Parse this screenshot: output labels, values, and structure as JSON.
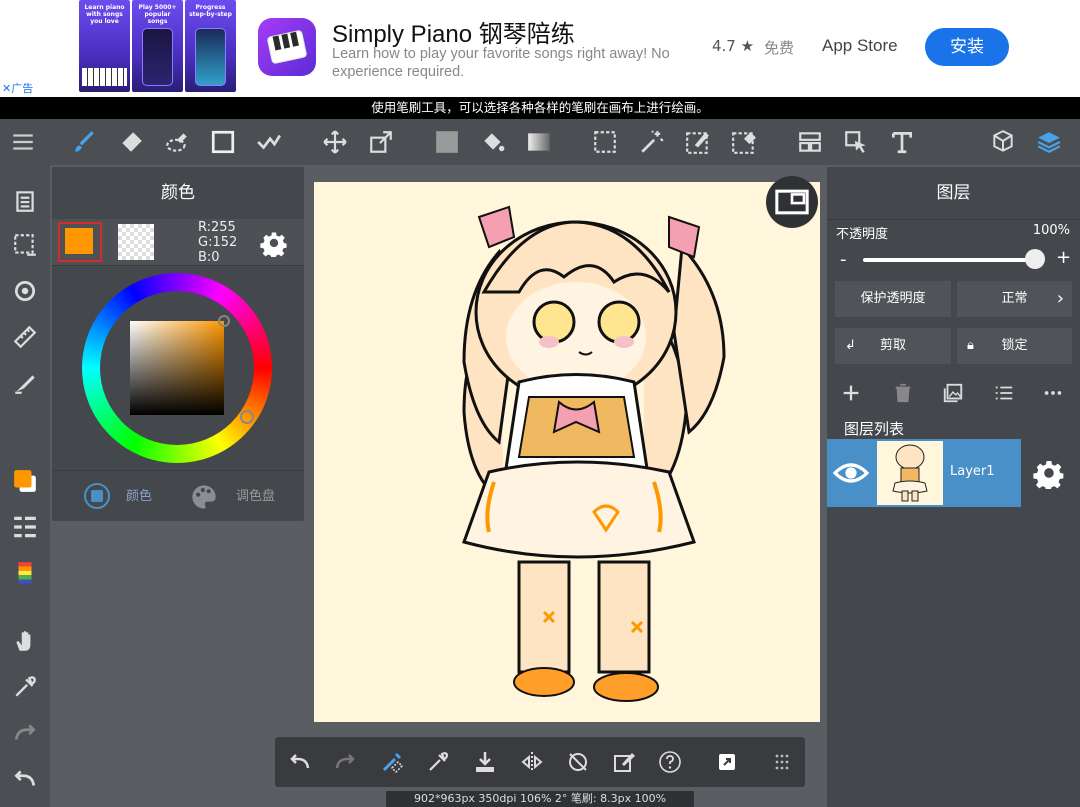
{
  "ad": {
    "close_label": "✕",
    "ad_label": "广告",
    "screenshots": [
      {
        "caption": "Learn piano with songs you love"
      },
      {
        "caption": "Play 5000+ popular songs"
      },
      {
        "caption": "Progress step-by-step"
      }
    ],
    "app_title": "Simply Piano 钢琴陪练",
    "app_desc": "Learn how to play your favorite songs right away! No experience required.",
    "rating": "4.7 ★",
    "price": "免费",
    "store": "App Store",
    "install": "安装"
  },
  "hint": "使用笔刷工具，可以选择各种各样的笔刷在画布上进行绘画。",
  "toolbar": {
    "left_tools": [
      "menu-icon",
      "brush-icon",
      "eraser-icon",
      "smudge-icon",
      "shape-icon",
      "correction-icon",
      "move-icon",
      "transform-icon",
      "fill-color-icon",
      "bucket-icon",
      "gradient-icon",
      "select-rect-icon",
      "magic-wand-icon",
      "select-pen-icon",
      "select-eraser-icon",
      "frame-icon",
      "select-layer-icon",
      "text-icon"
    ],
    "right_tools": [
      "3d-icon",
      "layers-icon"
    ]
  },
  "color_panel": {
    "title": "颜色",
    "primary_color": "#ff9800",
    "rgb_r": "R:255",
    "rgb_g": "G:152",
    "rgb_b": "B:0",
    "tab_color": "颜色",
    "tab_palette": "调色盘"
  },
  "layer_panel": {
    "title": "图层",
    "opacity_label": "不透明度",
    "opacity_value": "100%",
    "opacity_level": 1.0,
    "minus": "-",
    "plus": "+",
    "protect_alpha": "保护透明度",
    "blend_mode": "正常",
    "clip": "剪取",
    "lock": "锁定",
    "list_label": "图层列表",
    "layer_name": "Layer1"
  },
  "status": "902*963px 350dpi 106% 2° 笔刷: 8.3px 100%",
  "colors": {
    "accent": "#4a90c8",
    "install": "#1a73e8"
  }
}
